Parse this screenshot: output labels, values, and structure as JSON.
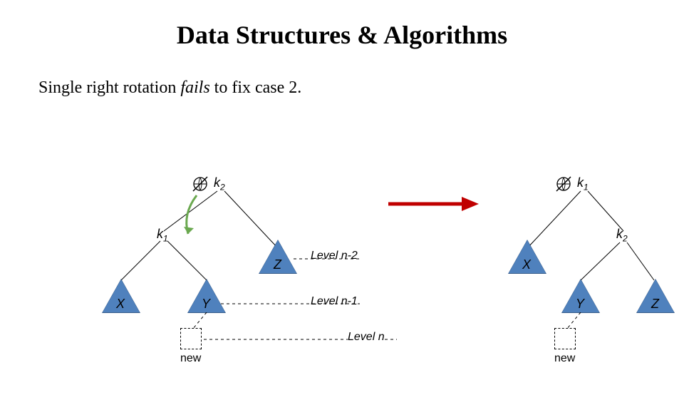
{
  "title": "Data Structures & Algorithms",
  "subtitle": {
    "prefix": "Single right rotation ",
    "emph": "fails",
    "suffix": " to fix case 2."
  },
  "left": {
    "root": "k",
    "root_sub": "2",
    "child": "k",
    "child_sub": "1",
    "X": "X",
    "Y": "Y",
    "Z": "Z",
    "new": "new"
  },
  "right": {
    "root": "k",
    "root_sub": "1",
    "child": "k",
    "child_sub": "2",
    "X": "X",
    "Y": "Y",
    "Z": "Z",
    "new": "new"
  },
  "levels": {
    "n2": "Level n-2",
    "n1": "Level n-1",
    "n": "Level n"
  }
}
